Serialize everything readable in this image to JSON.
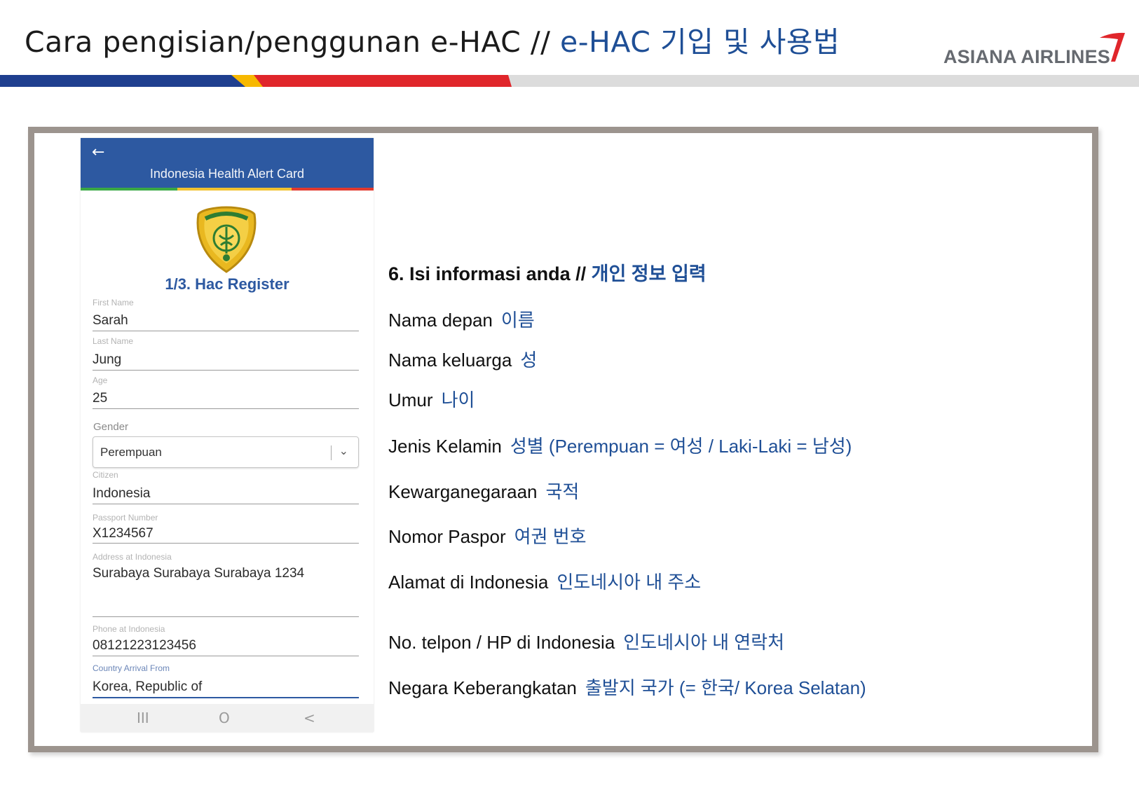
{
  "header": {
    "title_id": "Cara pengisian/penggunan e-HAC //",
    "title_ko": "e-HAC 기입 및 사용법",
    "logo_text": "ASIANA AIRLINES",
    "logo_mark": "asiana-wing-icon"
  },
  "colors": {
    "stripe_blue": "#1f3f8f",
    "stripe_red": "#e0262b",
    "stripe_yellow": "#f7b800",
    "stripe_gray": "#d9d9d9",
    "frame": "#9c948e",
    "app_blue": "#2d59a1",
    "korean_text": "#1f4f96"
  },
  "app": {
    "back_icon": "←",
    "title": "Indonesia Health Alert Card",
    "register_title": "1/3. Hac Register",
    "fields": [
      {
        "label": "First Name",
        "value": "Sarah"
      },
      {
        "label": "Last Name",
        "value": "Jung"
      },
      {
        "label": "Age",
        "value": "25"
      },
      {
        "label": "Citizen",
        "value": "Indonesia"
      },
      {
        "label": "Passport Number",
        "value": "X1234567"
      },
      {
        "label": "Address at Indonesia",
        "value": "Surabaya Surabaya Surabaya 1234"
      },
      {
        "label": "Phone at Indonesia",
        "value": "08121223123456"
      },
      {
        "label": "Country Arrival From",
        "value": "Korea, Republic of"
      }
    ],
    "gender": {
      "label": "Gender",
      "value": "Perempuan",
      "chevron": "⌄"
    },
    "nav": {
      "recents": "III",
      "home": "O",
      "back": "<"
    }
  },
  "instructions": {
    "heading_id": "6. Isi informasi anda //",
    "heading_ko": "개인 정보 입력",
    "rows": [
      {
        "id": "Nama  depan",
        "ko": "이름"
      },
      {
        "id": "Nama  keluarga",
        "ko": "성"
      },
      {
        "id": "Umur",
        "ko": "나이"
      },
      {
        "id": "Jenis Kelamin",
        "ko": "성별   (Perempuan  = 여성 / Laki-Laki  = 남성)"
      },
      {
        "id": "Kewarganegaraan",
        "ko": "국적"
      },
      {
        "id": "Nomor  Paspor",
        "ko": "여권 번호"
      },
      {
        "id": "Alamat  di Indonesia",
        "ko": "인도네시아 내 주소"
      },
      {
        "id": "No.  telpon  / HP di Indonesia",
        "ko": "인도네시아 내 연락처"
      },
      {
        "id": "Negara  Keberangkatan",
        "ko": "출발지 국가 (= 한국/ Korea Selatan)"
      }
    ]
  }
}
